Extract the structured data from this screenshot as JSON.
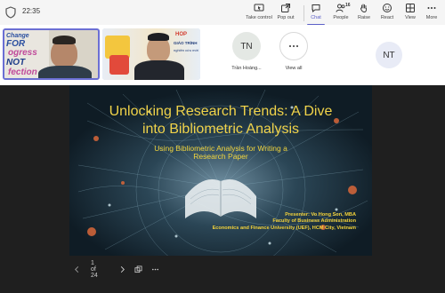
{
  "toolbar": {
    "time": "22:35",
    "buttons": [
      {
        "id": "take-control",
        "label": "Take control",
        "icon": "take-control-icon"
      },
      {
        "id": "pop-out",
        "label": "Pop out",
        "icon": "pop-out-icon"
      },
      {
        "id": "chat",
        "label": "Chat",
        "icon": "chat-icon"
      },
      {
        "id": "people",
        "label": "People",
        "icon": "people-icon",
        "count": "16"
      },
      {
        "id": "raise",
        "label": "Raise",
        "icon": "raise-hand-icon"
      },
      {
        "id": "react",
        "label": "React",
        "icon": "react-icon"
      },
      {
        "id": "view",
        "label": "View",
        "icon": "view-grid-icon"
      },
      {
        "id": "more",
        "label": "More",
        "icon": "more-icon"
      }
    ],
    "active_button": "chat"
  },
  "participants": {
    "tile1_poster": [
      "Change",
      "FOR",
      "ogress",
      "NOT",
      "fection"
    ],
    "tile2_poster": [
      "HOP",
      "GIÁO TRÌNH",
      "nghiên cứu mới"
    ],
    "avatar_tn": {
      "initials": "TN",
      "name": "Trần Hoàng..."
    },
    "view_all": {
      "label": "View all"
    },
    "avatar_nt": {
      "initials": "NT"
    }
  },
  "slide": {
    "title_line1": "Unlocking Research Trends: A Dive",
    "title_line2": "into Bibliometric Analysis",
    "subtitle_line1": "Using Bibliometric Analysis for Writing a",
    "subtitle_line2": "Research Paper",
    "presenter": "Presenter: Vo Hong Son, MBA",
    "faculty": "Faculty of Business Administration",
    "university": "Economics and Finance University (UEF), HCM City, Vietnam"
  },
  "slide_controls": {
    "page_indicator": "1 of 24"
  },
  "colors": {
    "accent": "#5b5fc7",
    "slide_text": "#f0d34a",
    "stage_bg": "#1f1f1f"
  }
}
